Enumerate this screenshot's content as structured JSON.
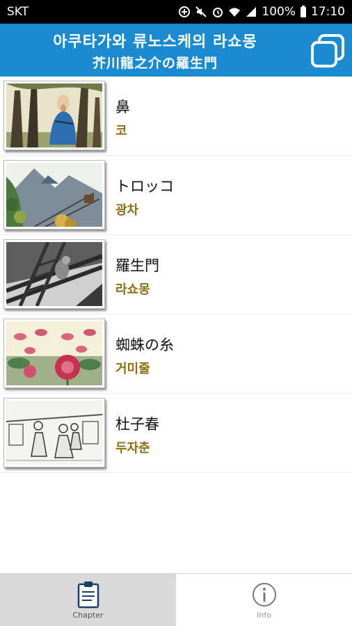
{
  "status_bar": {
    "carrier": "SKT",
    "battery": "100%",
    "time": "17:10"
  },
  "header": {
    "title": "아쿠타가와 류노스케의 라쇼몽",
    "subtitle": "芥川龍之介の羅生門",
    "window_icon": "window-stack-icon"
  },
  "chapters": [
    {
      "title": "鼻",
      "subtitle": "코",
      "image": "monk-in-forest"
    },
    {
      "title": "トロッコ",
      "subtitle": "광차",
      "image": "mountain-railway"
    },
    {
      "title": "羅生門",
      "subtitle": "라쇼몽",
      "image": "gate-ladder"
    },
    {
      "title": "蜘蛛の糸",
      "subtitle": "거미줄",
      "image": "lotus-pond"
    },
    {
      "title": "杜子春",
      "subtitle": "두자춘",
      "image": "village-crowd"
    }
  ],
  "bottom_nav": {
    "tabs": [
      {
        "label": "Chapter",
        "icon": "clipboard-icon",
        "active": true
      },
      {
        "label": "Info",
        "icon": "info-circle-icon",
        "active": false
      }
    ]
  },
  "colors": {
    "header_bg": "#1b8bd1",
    "subtitle_text": "#8c6d12",
    "active_tab_bg": "#d9d9d9"
  }
}
